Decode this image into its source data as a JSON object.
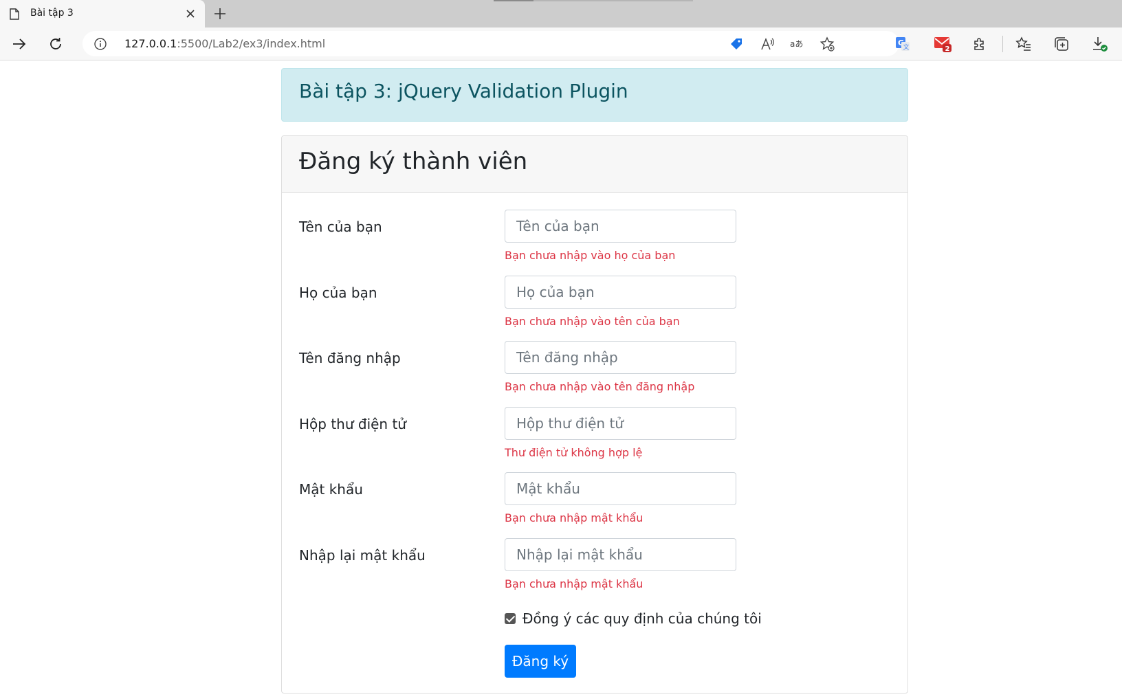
{
  "browser": {
    "tab_title": "Bài tập 3",
    "url_host": "127.0.0.1",
    "url_rest": ":5500/Lab2/ex3/index.html",
    "mail_badge": "2"
  },
  "page": {
    "alert_title": "Bài tập 3: jQuery Validation Plugin",
    "card_title": "Đăng ký thành viên",
    "fields": [
      {
        "label": "Tên của bạn",
        "placeholder": "Tên của bạn",
        "error": "Bạn chưa nhập vào họ của bạn"
      },
      {
        "label": "Họ của bạn",
        "placeholder": "Họ của bạn",
        "error": "Bạn chưa nhập vào tên của bạn"
      },
      {
        "label": "Tên đăng nhập",
        "placeholder": "Tên đăng nhập",
        "error": "Bạn chưa nhập vào tên đăng nhập"
      },
      {
        "label": "Hộp thư điện tử",
        "placeholder": "Hộp thư điện tử",
        "error": "Thư điện tử không hợp lệ"
      },
      {
        "label": "Mật khẩu",
        "placeholder": "Mật khẩu",
        "error": "Bạn chưa nhập mật khẩu"
      },
      {
        "label": "Nhập lại mật khẩu",
        "placeholder": "Nhập lại mật khẩu",
        "error": "Bạn chưa nhập mật khẩu"
      }
    ],
    "agree_label": "Đồng ý các quy định của chúng tôi",
    "agree_checked": true,
    "submit_label": "Đăng ký"
  },
  "colors": {
    "alert_bg": "#d1ecf1",
    "alert_text": "#0c5460",
    "error": "#dc3545",
    "primary": "#007bff"
  }
}
